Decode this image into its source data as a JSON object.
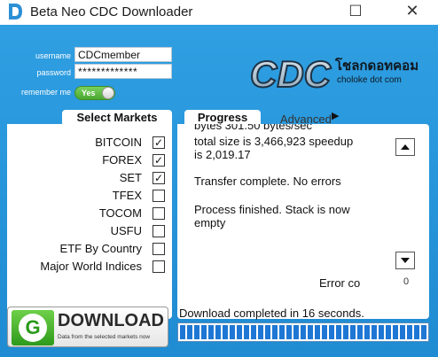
{
  "window": {
    "title": "Beta Neo CDC Downloader",
    "maximize_glyph": "☐",
    "close_glyph": "✕"
  },
  "login": {
    "username_label": "username",
    "username_value": "CDCmember",
    "password_label": "password",
    "password_value": "*************",
    "remember_label": "remember me",
    "remember_toggle_text": "Yes",
    "remember_on": true
  },
  "logo": {
    "letters": "CDC",
    "thai_text": "โชลกดอทคอม",
    "subtitle": "choloke dot com"
  },
  "markets": {
    "tab_label": "Select Markets",
    "items": [
      {
        "label": "BITCOIN",
        "checked": true
      },
      {
        "label": "FOREX",
        "checked": true
      },
      {
        "label": "SET",
        "checked": true
      },
      {
        "label": "TFEX",
        "checked": false
      },
      {
        "label": "TOCOM",
        "checked": false
      },
      {
        "label": "USFU",
        "checked": false
      },
      {
        "label": "ETF By Country",
        "checked": false
      },
      {
        "label": "Major World Indices",
        "checked": false
      }
    ]
  },
  "progress": {
    "tab_label": "Progress",
    "advanced_tab_label": "Advanced O",
    "log_partial_top": "bytes 301.50 bytes/sec",
    "log_lines": [
      "total size is 3,466,923  speedup",
      "is 2,019.17",
      "",
      "Transfer complete. No errors",
      "",
      "Process finished. Stack is now",
      "empty"
    ],
    "error_label": "Error co",
    "error_count": "0"
  },
  "download": {
    "logo_letter": "G",
    "title": "DOWNLOAD",
    "subtitle": "Data from the selected markets now",
    "status": "Download completed in 16 seconds.",
    "progress_fraction": 1.0
  },
  "colors": {
    "background": "#2196dc",
    "toggle_on": "#5fbf3f",
    "progress_fill": "#1e77d4"
  }
}
